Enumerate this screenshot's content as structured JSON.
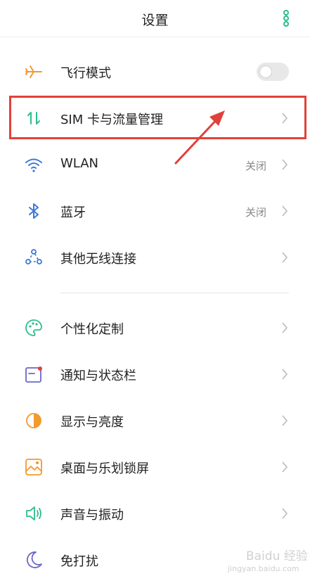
{
  "header": {
    "title": "设置",
    "menu_icon": "more-vertical-icon"
  },
  "colors": {
    "accent": "#2dbd8f",
    "highlight": "#e0413a",
    "orange": "#f29a2e",
    "blue": "#3b78d8",
    "purple": "#6a67c9"
  },
  "section1": [
    {
      "label": "飞行模式",
      "icon": "airplane-icon",
      "control": "toggle",
      "toggle_on": false
    },
    {
      "label": "SIM 卡与流量管理",
      "icon": "sim-data-icon",
      "status": ""
    },
    {
      "label": "WLAN",
      "icon": "wifi-icon",
      "status": "关闭"
    },
    {
      "label": "蓝牙",
      "icon": "bluetooth-icon",
      "status": "关闭"
    },
    {
      "label": "其他无线连接",
      "icon": "wireless-connections-icon",
      "status": ""
    }
  ],
  "section2": [
    {
      "label": "个性化定制",
      "icon": "palette-icon"
    },
    {
      "label": "通知与状态栏",
      "icon": "notification-icon"
    },
    {
      "label": "显示与亮度",
      "icon": "brightness-icon"
    },
    {
      "label": "桌面与乐划锁屏",
      "icon": "wallpaper-icon"
    },
    {
      "label": "声音与振动",
      "icon": "speaker-icon"
    },
    {
      "label": "免打扰",
      "icon": "moon-icon"
    }
  ],
  "watermark": {
    "line1": "Baidu 经验",
    "line2": "jingyan.baidu.com"
  }
}
